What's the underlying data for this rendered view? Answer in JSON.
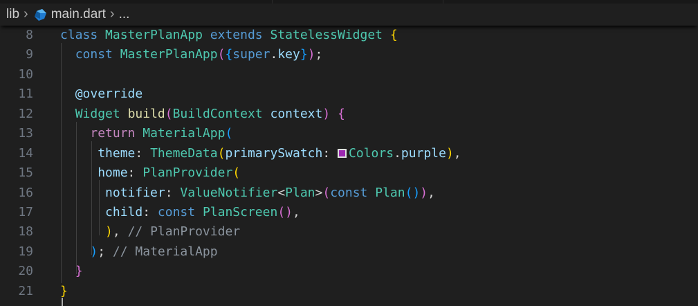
{
  "breadcrumb": {
    "folder": "lib",
    "file": "main.dart",
    "ellipsis": "..."
  },
  "swatch_color": "#9c27b0",
  "lines": [
    {
      "num": "8",
      "tokens": [
        {
          "t": "class",
          "c": "kw"
        },
        {
          "t": " ",
          "c": "w"
        },
        {
          "t": "MasterPlanApp",
          "c": "type"
        },
        {
          "t": " ",
          "c": "w"
        },
        {
          "t": "extends",
          "c": "kw"
        },
        {
          "t": " ",
          "c": "w"
        },
        {
          "t": "StatelessWidget",
          "c": "type"
        },
        {
          "t": " ",
          "c": "w"
        },
        {
          "t": "{",
          "c": "p1"
        }
      ]
    },
    {
      "num": "9",
      "tokens": [
        {
          "t": "  ",
          "c": "w"
        },
        {
          "t": "const",
          "c": "kw"
        },
        {
          "t": " ",
          "c": "w"
        },
        {
          "t": "MasterPlanApp",
          "c": "type"
        },
        {
          "t": "(",
          "c": "p2"
        },
        {
          "t": "{",
          "c": "p3"
        },
        {
          "t": "super",
          "c": "kw"
        },
        {
          "t": ".",
          "c": "w"
        },
        {
          "t": "key",
          "c": "var"
        },
        {
          "t": "}",
          "c": "p3"
        },
        {
          "t": ")",
          "c": "p2"
        },
        {
          "t": ";",
          "c": "w"
        }
      ]
    },
    {
      "num": "10",
      "tokens": []
    },
    {
      "num": "11",
      "tokens": [
        {
          "t": "  ",
          "c": "w"
        },
        {
          "t": "@override",
          "c": "var"
        }
      ]
    },
    {
      "num": "12",
      "tokens": [
        {
          "t": "  ",
          "c": "w"
        },
        {
          "t": "Widget",
          "c": "type"
        },
        {
          "t": " ",
          "c": "w"
        },
        {
          "t": "build",
          "c": "fn"
        },
        {
          "t": "(",
          "c": "p2"
        },
        {
          "t": "BuildContext",
          "c": "type"
        },
        {
          "t": " ",
          "c": "w"
        },
        {
          "t": "context",
          "c": "var"
        },
        {
          "t": ")",
          "c": "p2"
        },
        {
          "t": " ",
          "c": "w"
        },
        {
          "t": "{",
          "c": "p2"
        }
      ]
    },
    {
      "num": "13",
      "tokens": [
        {
          "t": "    ",
          "c": "w"
        },
        {
          "t": "return",
          "c": "ctl"
        },
        {
          "t": " ",
          "c": "w"
        },
        {
          "t": "MaterialApp",
          "c": "type"
        },
        {
          "t": "(",
          "c": "p3"
        }
      ]
    },
    {
      "num": "14",
      "tokens": [
        {
          "t": "     ",
          "c": "w"
        },
        {
          "t": "theme",
          "c": "var"
        },
        {
          "t": ": ",
          "c": "w"
        },
        {
          "t": "ThemeData",
          "c": "type"
        },
        {
          "t": "(",
          "c": "p1"
        },
        {
          "t": "primarySwatch",
          "c": "var"
        },
        {
          "t": ": ",
          "c": "w"
        },
        {
          "t": "",
          "c": "swatch"
        },
        {
          "t": "Colors",
          "c": "type"
        },
        {
          "t": ".",
          "c": "w"
        },
        {
          "t": "purple",
          "c": "var"
        },
        {
          "t": ")",
          "c": "p1"
        },
        {
          "t": ",",
          "c": "w"
        }
      ]
    },
    {
      "num": "15",
      "tokens": [
        {
          "t": "     ",
          "c": "w"
        },
        {
          "t": "home",
          "c": "var"
        },
        {
          "t": ": ",
          "c": "w"
        },
        {
          "t": "PlanProvider",
          "c": "type"
        },
        {
          "t": "(",
          "c": "p1"
        }
      ]
    },
    {
      "num": "16",
      "tokens": [
        {
          "t": "      ",
          "c": "w"
        },
        {
          "t": "notifier",
          "c": "var"
        },
        {
          "t": ": ",
          "c": "w"
        },
        {
          "t": "ValueNotifier",
          "c": "type"
        },
        {
          "t": "<",
          "c": "w"
        },
        {
          "t": "Plan",
          "c": "type"
        },
        {
          "t": ">",
          "c": "w"
        },
        {
          "t": "(",
          "c": "p2"
        },
        {
          "t": "const",
          "c": "kw"
        },
        {
          "t": " ",
          "c": "w"
        },
        {
          "t": "Plan",
          "c": "type"
        },
        {
          "t": "(",
          "c": "p3"
        },
        {
          "t": ")",
          "c": "p3"
        },
        {
          "t": ")",
          "c": "p2"
        },
        {
          "t": ",",
          "c": "w"
        }
      ]
    },
    {
      "num": "17",
      "tokens": [
        {
          "t": "      ",
          "c": "w"
        },
        {
          "t": "child",
          "c": "var"
        },
        {
          "t": ": ",
          "c": "w"
        },
        {
          "t": "const",
          "c": "kw"
        },
        {
          "t": " ",
          "c": "w"
        },
        {
          "t": "PlanScreen",
          "c": "type"
        },
        {
          "t": "(",
          "c": "p2"
        },
        {
          "t": ")",
          "c": "p2"
        },
        {
          "t": ",",
          "c": "w"
        }
      ]
    },
    {
      "num": "18",
      "tokens": [
        {
          "t": "      ",
          "c": "w"
        },
        {
          "t": ")",
          "c": "p1"
        },
        {
          "t": ", ",
          "c": "w"
        },
        {
          "t": "// PlanProvider",
          "c": "com"
        }
      ]
    },
    {
      "num": "19",
      "tokens": [
        {
          "t": "    ",
          "c": "w"
        },
        {
          "t": ")",
          "c": "p3"
        },
        {
          "t": "; ",
          "c": "w"
        },
        {
          "t": "// MaterialApp",
          "c": "com"
        }
      ]
    },
    {
      "num": "20",
      "tokens": [
        {
          "t": "  ",
          "c": "w"
        },
        {
          "t": "}",
          "c": "p2"
        }
      ]
    },
    {
      "num": "21",
      "tokens": [
        {
          "t": "}",
          "c": "p1"
        }
      ]
    }
  ]
}
